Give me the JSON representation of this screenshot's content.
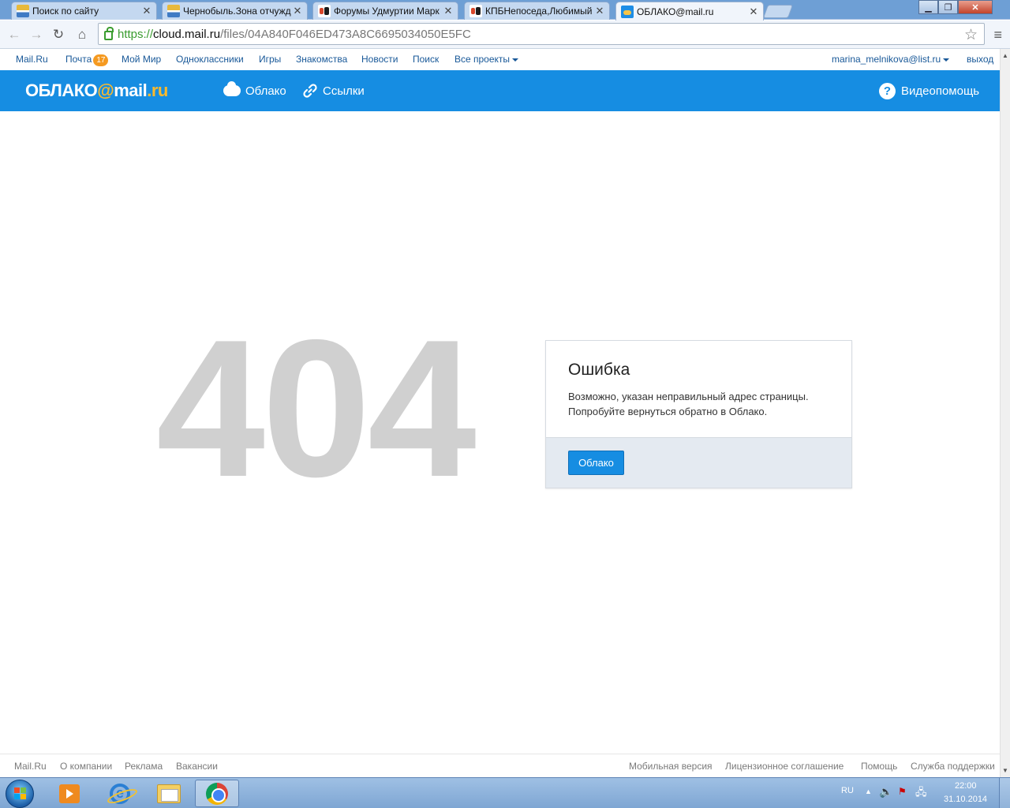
{
  "browser": {
    "tabs": [
      {
        "title": "Поиск по сайту",
        "icon": "bar-chart-favicon"
      },
      {
        "title": "Чернобыль.Зона отчужд",
        "icon": "bar-chart-favicon"
      },
      {
        "title": "Форумы Удмуртии Марк",
        "icon": "forum-favicon"
      },
      {
        "title": "КПБНепоседа,Любимый",
        "icon": "forum-favicon"
      },
      {
        "title": "ОБЛАКО@mail.ru",
        "icon": "cloud-favicon",
        "active": true
      }
    ],
    "url": {
      "scheme": "https://",
      "host": "cloud.mail.ru",
      "path": "/files/04A840F046ED473A8C6695034050E5FC"
    }
  },
  "portal": {
    "links": {
      "mailru": "Mail.Ru",
      "pochta": "Почта",
      "moimir": "Мой Мир",
      "ok": "Одноклассники",
      "igry": "Игры",
      "znakomstva": "Знакомства",
      "novosti": "Новости",
      "poisk": "Поиск",
      "vse": "Все проекты"
    },
    "mail_count": "17",
    "user": "marina_melnikova@list.ru",
    "logout": "выход"
  },
  "header": {
    "logo_main": "ОБЛАКО",
    "logo_at": "@",
    "logo_mail": "mail",
    "logo_ru": ".ru",
    "nav_cloud": "Облако",
    "nav_links": "Ссылки",
    "help": "Видеопомощь",
    "colors": {
      "bar": "#168de2",
      "accent": "#f9b92d"
    }
  },
  "error": {
    "code": "404",
    "title": "Ошибка",
    "line1": "Возможно, указан неправильный адрес страницы.",
    "line2": "Попробуйте вернуться обратно в Облако.",
    "button": "Облако"
  },
  "footer": {
    "mailru": "Mail.Ru",
    "about": "О компании",
    "ads": "Реклама",
    "jobs": "Вакансии",
    "mobile": "Мобильная версия",
    "license": "Лицензионное соглашение",
    "help": "Помощь",
    "support": "Служба поддержки"
  },
  "taskbar": {
    "lang": "RU",
    "time": "22:00",
    "date": "31.10.2014"
  }
}
